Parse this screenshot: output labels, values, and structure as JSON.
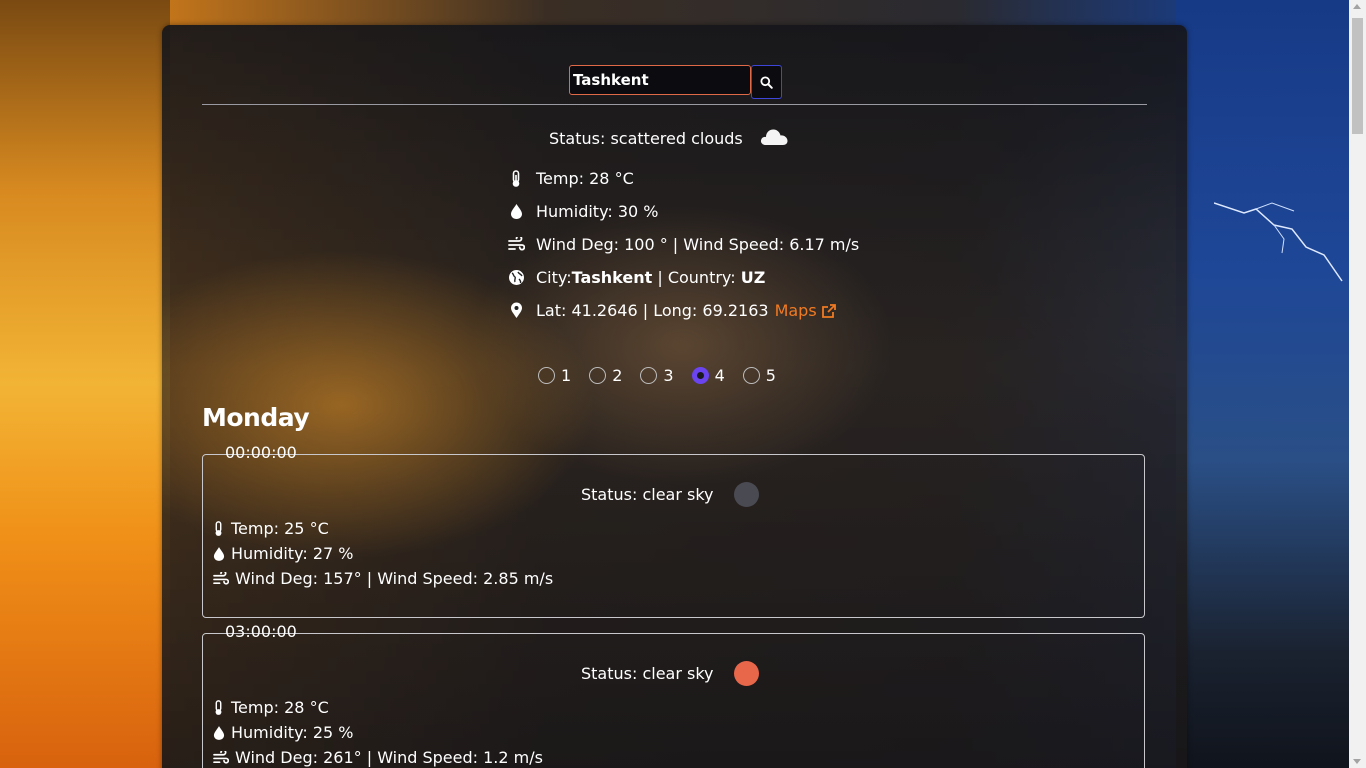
{
  "search": {
    "value": "Tashkent"
  },
  "current": {
    "status": "Status: scattered clouds",
    "temp": "Temp: 28 °C",
    "humidity": "Humidity: 30 %",
    "wind": "Wind Deg: 100 ° | Wind Speed: 6.17 m/s",
    "city_prefix": "City: ",
    "city": "Tashkent",
    "country_prefix": " | Country: ",
    "country": "UZ",
    "coords": "Lat: 41.2646 | Long: 69.2163",
    "maps_label": "Maps"
  },
  "days": {
    "options": [
      "1",
      "2",
      "3",
      "4",
      "5"
    ],
    "selected": "4"
  },
  "day_title": "Monday",
  "slots": [
    {
      "time": "00:00:00",
      "status": "Status: clear sky",
      "icon_color": "#4a4a52",
      "temp": "Temp: 25 °C",
      "humidity": "Humidity: 27 %",
      "wind": "Wind Deg: 157° | Wind Speed: 2.85 m/s"
    },
    {
      "time": "03:00:00",
      "status": "Status: clear sky",
      "icon_color": "#e8664a",
      "temp": "Temp: 28 °C",
      "humidity": "Humidity: 25 %",
      "wind": "Wind Deg: 261° | Wind Speed: 1.2 m/s"
    }
  ],
  "colors": {
    "accent_link": "#f07a22",
    "radio_checked": "#6a44ee",
    "search_border": "#e06a48",
    "search_button_border": "#3d46d8"
  }
}
